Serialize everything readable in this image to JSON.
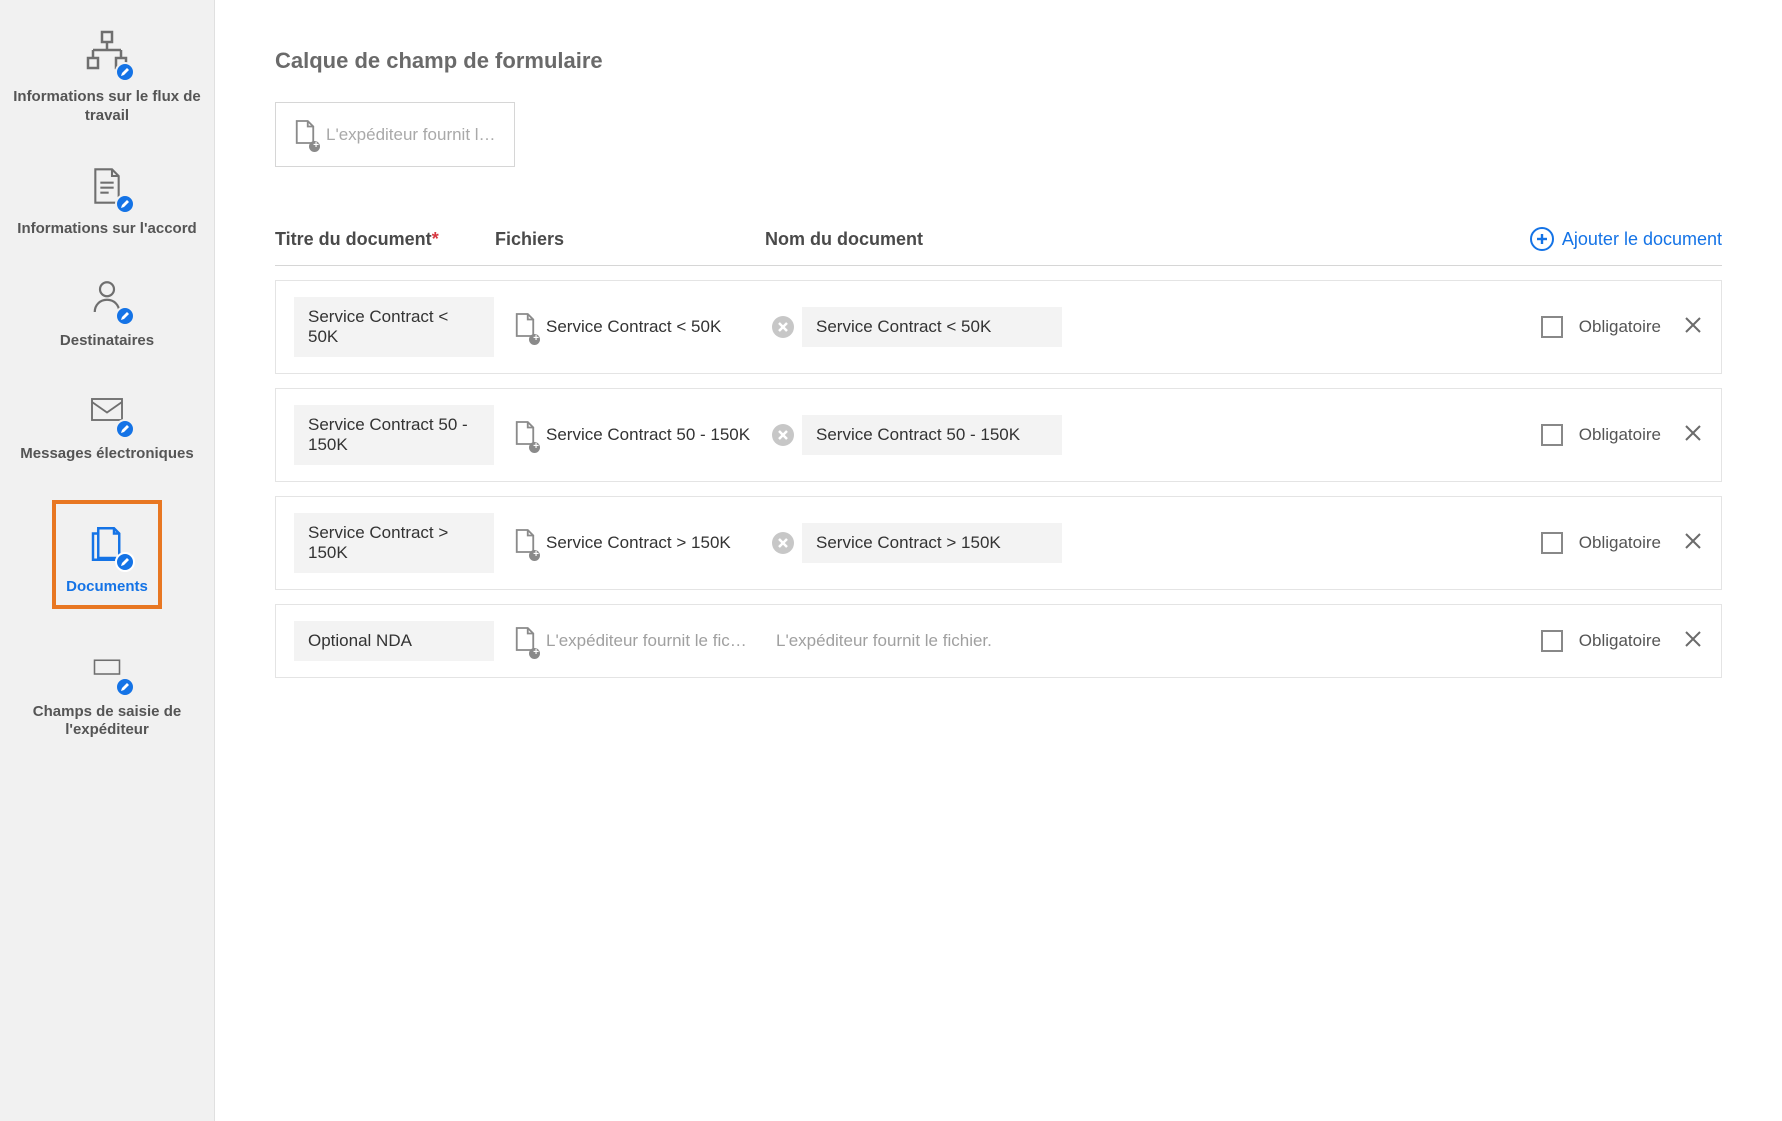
{
  "sidebar": {
    "items": [
      {
        "label": "Informations sur le flux de travail",
        "icon": "flow-icon"
      },
      {
        "label": "Informations sur l'accord",
        "icon": "agreement-icon"
      },
      {
        "label": "Destinataires",
        "icon": "recipients-icon"
      },
      {
        "label": "Messages électroniques",
        "icon": "emails-icon"
      },
      {
        "label": "Documents",
        "icon": "documents-icon",
        "active": true
      },
      {
        "label": "Champs de saisie de l'expéditeur",
        "icon": "sender-fields-icon"
      }
    ]
  },
  "main": {
    "section_title": "Calque de champ de formulaire",
    "layer_placeholder": "L'expéditeur fournit l…",
    "columns": {
      "title": "Titre du document",
      "files": "Fichiers",
      "name": "Nom du document"
    },
    "add_document_label": "Ajouter le document",
    "mandatory_label": "Obligatoire",
    "rows": [
      {
        "title": "Service Contract < 50K",
        "file": "Service Contract < 50K",
        "has_file": true,
        "name": "Service Contract < 50K",
        "has_name": true,
        "mandatory": false
      },
      {
        "title": "Service Contract 50 - 150K",
        "file": "Service Contract 50 - 150K",
        "has_file": true,
        "name": "Service Contract 50 - 150K",
        "has_name": true,
        "mandatory": false
      },
      {
        "title": "Service Contract > 150K",
        "file": "Service Contract > 150K",
        "has_file": true,
        "name": "Service Contract  > 150K",
        "has_name": true,
        "mandatory": false
      },
      {
        "title": "Optional NDA",
        "file": "L'expéditeur fournit le fic…",
        "has_file": false,
        "name": "L'expéditeur fournit le fichier.",
        "has_name": false,
        "mandatory": false
      }
    ]
  }
}
